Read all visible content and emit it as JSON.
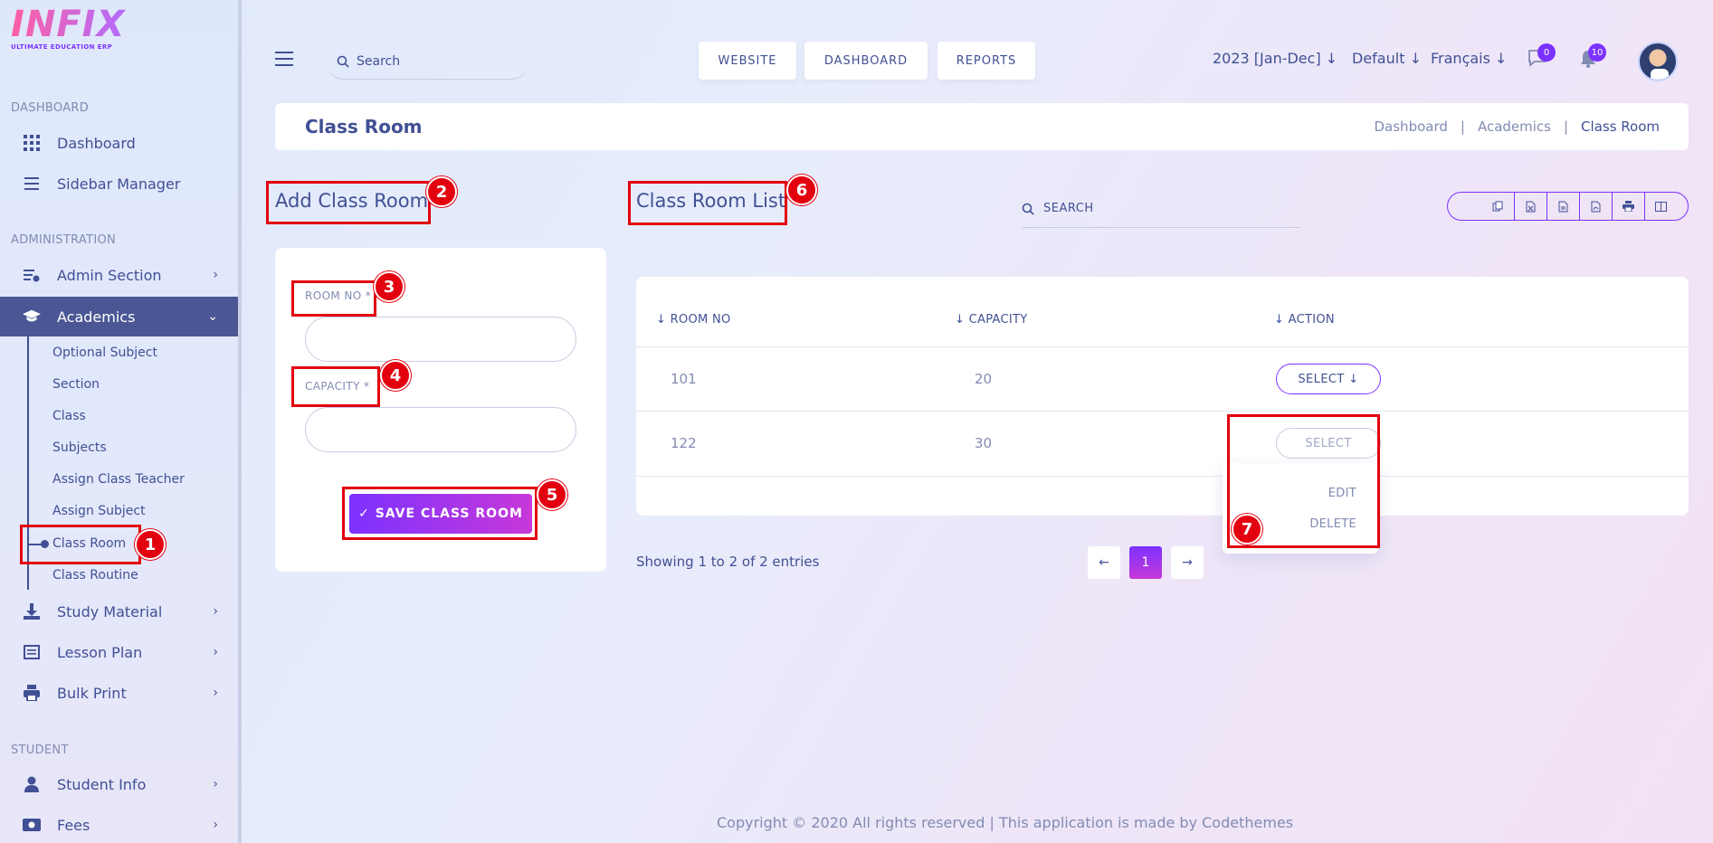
{
  "brand": {
    "logo_text": "INFIX",
    "logo_sub": "ULTIMATE EDUCATION ERP"
  },
  "sidebar": {
    "sections": [
      "DASHBOARD",
      "ADMINISTRATION",
      "STUDENT"
    ],
    "items": [
      {
        "label": "Dashboard",
        "icon": "grid-icon"
      },
      {
        "label": "Sidebar Manager",
        "icon": "bars-icon"
      },
      {
        "label": "Admin Section",
        "icon": "admin-icon"
      },
      {
        "label": "Academics",
        "icon": "graduation-cap-icon"
      },
      {
        "label": "Study Material",
        "icon": "download-icon"
      },
      {
        "label": "Lesson Plan",
        "icon": "list-icon"
      },
      {
        "label": "Bulk Print",
        "icon": "print-icon"
      },
      {
        "label": "Student Info",
        "icon": "user-icon"
      },
      {
        "label": "Fees",
        "icon": "money-icon"
      }
    ],
    "sub_items": [
      "Optional Subject",
      "Section",
      "Class",
      "Subjects",
      "Assign Class Teacher",
      "Assign Subject",
      "Class Room",
      "Class Routine"
    ]
  },
  "topbar": {
    "search_placeholder": "Search",
    "buttons": [
      "WEBSITE",
      "DASHBOARD",
      "REPORTS"
    ],
    "year": "2023 [Jan-Dec]",
    "theme": "Default",
    "language": "Français",
    "messages_count": "0",
    "notifications_count": "10"
  },
  "page": {
    "title": "Class Room",
    "breadcrumb": [
      "Dashboard",
      "Academics",
      "Class Room"
    ]
  },
  "add_form": {
    "heading": "Add Class Room",
    "room_no_label": "ROOM NO *",
    "capacity_label": "CAPACITY *",
    "save_label": "SAVE CLASS ROOM"
  },
  "list": {
    "heading": "Class Room List",
    "search_placeholder": "SEARCH",
    "columns": [
      "ROOM NO",
      "CAPACITY",
      "ACTION"
    ],
    "rows": [
      {
        "room_no": "101",
        "capacity": "20",
        "action": "SELECT"
      },
      {
        "room_no": "122",
        "capacity": "30",
        "action": "SELECT"
      }
    ],
    "dropdown": [
      "EDIT",
      "DELETE"
    ],
    "showing": "Showing 1 to 2 of 2 entries",
    "current_page": "1"
  },
  "annotations": [
    "1",
    "2",
    "3",
    "4",
    "5",
    "6",
    "7"
  ],
  "footer": "Copyright © 2020 All rights reserved | This application is made by Codethemes",
  "colors": {
    "primary": "#415094",
    "accent": "#7c32ff",
    "annotation": "#e3000f"
  }
}
